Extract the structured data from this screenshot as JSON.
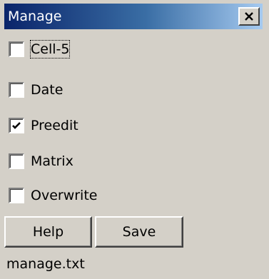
{
  "window": {
    "title": "Manage"
  },
  "checkboxes": [
    {
      "label": "Cell-5",
      "checked": false,
      "focused": true
    },
    {
      "label": "Date",
      "checked": false,
      "focused": false
    },
    {
      "label": "Preedit",
      "checked": true,
      "focused": false
    },
    {
      "label": "Matrix",
      "checked": false,
      "focused": false
    },
    {
      "label": "Overwrite",
      "checked": false,
      "focused": false
    }
  ],
  "buttons": {
    "help_label": "Help",
    "save_label": "Save"
  },
  "status": {
    "filename": "manage.txt"
  },
  "colors": {
    "titlebar_start": "#0a246a",
    "titlebar_end": "#a6caf0",
    "face": "#d4d0c8"
  },
  "icons": {
    "close": "close-icon",
    "check": "checkmark-icon"
  }
}
